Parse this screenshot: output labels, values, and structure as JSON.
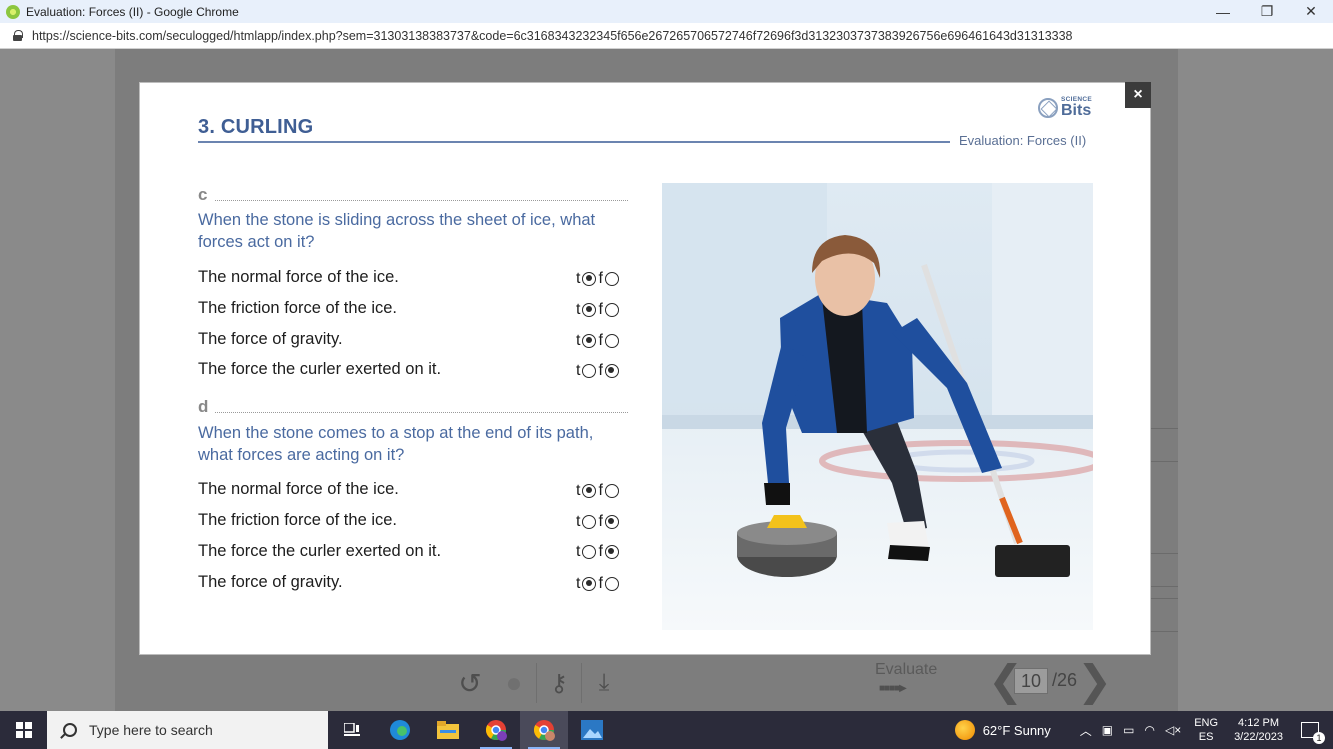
{
  "browser": {
    "window_title": "Evaluation: Forces (II) - Google Chrome",
    "url": "https://science-bits.com/seculogged/htmlapp/index.php?sem=3130313838373​7&code=6c3168343232345f656e267265706572746f72696f3d3132303737383926756e696461643d31313338",
    "minimize": "—",
    "restore": "❐",
    "close": "✕"
  },
  "modal": {
    "title": "3. CURLING",
    "subtitle": "Evaluation: Forces (II)",
    "close_label": "×",
    "logo_small": "SCIENCE",
    "logo_big": "Bits",
    "tf_true": "t",
    "tf_false": "f",
    "parts": [
      {
        "label": "c",
        "question": "When the stone is sliding across the sheet of ice, what forces act on it?",
        "statements": [
          {
            "text": "The normal force of the ice.",
            "answer": "t"
          },
          {
            "text": "The friction force of the ice.",
            "answer": "t"
          },
          {
            "text": "The force of gravity.",
            "answer": "t"
          },
          {
            "text": "The force the curler exerted on it.",
            "answer": "f"
          }
        ]
      },
      {
        "label": "d",
        "question": "When the stone comes to a stop at the end of its path, what forces are acting on it?",
        "statements": [
          {
            "text": "The normal force of the ice.",
            "answer": "t"
          },
          {
            "text": "The friction force of the ice.",
            "answer": "f"
          },
          {
            "text": "The force the curler exerted on it.",
            "answer": "f"
          },
          {
            "text": "The force of gravity.",
            "answer": "t"
          }
        ]
      }
    ]
  },
  "toolbar": {
    "evaluate_label": "Evaluate",
    "page_current": "10",
    "page_total": "/26"
  },
  "taskbar": {
    "search_placeholder": "Type here to search",
    "weather": "62°F  Sunny",
    "lang_top": "ENG",
    "lang_bottom": "ES",
    "time": "4:12 PM",
    "date": "3/22/2023"
  },
  "colors": {
    "accent_blue": "#3f5e94",
    "question_blue": "#4a6aa0",
    "taskbar": "#2b2b3a"
  }
}
